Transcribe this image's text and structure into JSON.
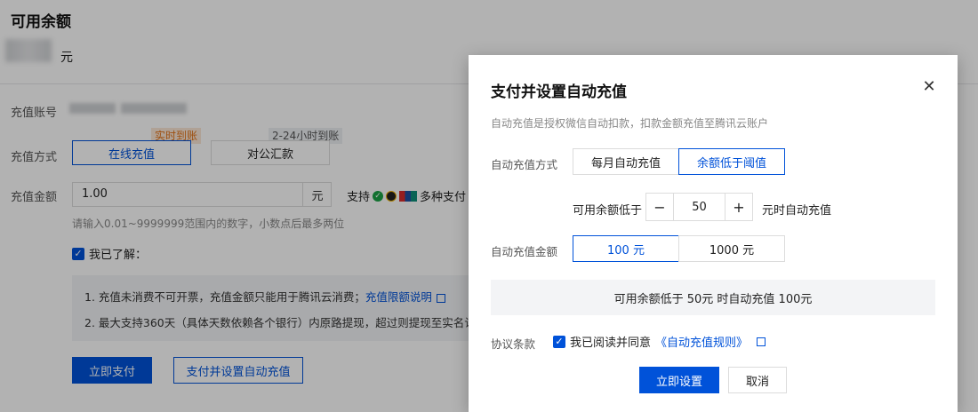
{
  "page": {
    "balance_title": "可用余额",
    "balance_unit": "元",
    "recharge_account_label": "充值账号",
    "recharge_method_label": "充值方式",
    "recharge_amount_label": "充值金额",
    "methods": [
      {
        "label": "在线充值",
        "tag": "实时到账",
        "active": true
      },
      {
        "label": "对公汇款",
        "tag": "2-24小时到账",
        "active": false
      }
    ],
    "amount_value": "1.00",
    "amount_unit": "元",
    "support_prefix": "支持",
    "support_suffix": "多种支付",
    "amount_hint": "请输入0.01~9999999范围内的数字，小数点后最多两位",
    "ack_label": "我已了解：",
    "notice_1": "1. 充值未消费不可开票，充值金额只能用于腾讯云消费；",
    "notice_1_link": "充值限额说明",
    "notice_2": "2. 最大支持360天（具体天数依赖各个银行）内原路提现，超过则提现至实名认证",
    "pay_now_button": "立即支付",
    "pay_auto_button": "支付并设置自动充值"
  },
  "modal": {
    "title": "支付并设置自动充值",
    "close_icon": "close-icon",
    "description": "自动充值是授权微信自动扣款，扣款金额充值至腾讯云账户",
    "auto_method_label": "自动充值方式",
    "auto_methods": [
      {
        "label": "每月自动充值",
        "active": false
      },
      {
        "label": "余额低于阈值",
        "active": true
      }
    ],
    "threshold_prefix": "可用余额低于",
    "threshold_value": "50",
    "threshold_suffix": "元时自动充值",
    "amount_label": "自动充值金额",
    "amounts": [
      {
        "label": "100 元",
        "active": true
      },
      {
        "label": "1000 元",
        "active": false
      }
    ],
    "summary": "可用余额低于 50元 时自动充值 100元",
    "agreement_label": "协议条款",
    "agreement_text": "我已阅读并同意",
    "agreement_link": "《自动充值规则》",
    "confirm_button": "立即设置",
    "cancel_button": "取消"
  },
  "colors": {
    "accent": "#0052d9",
    "mask": "rgba(0,0,0,0.3)",
    "tag_orange": "#e37318"
  }
}
